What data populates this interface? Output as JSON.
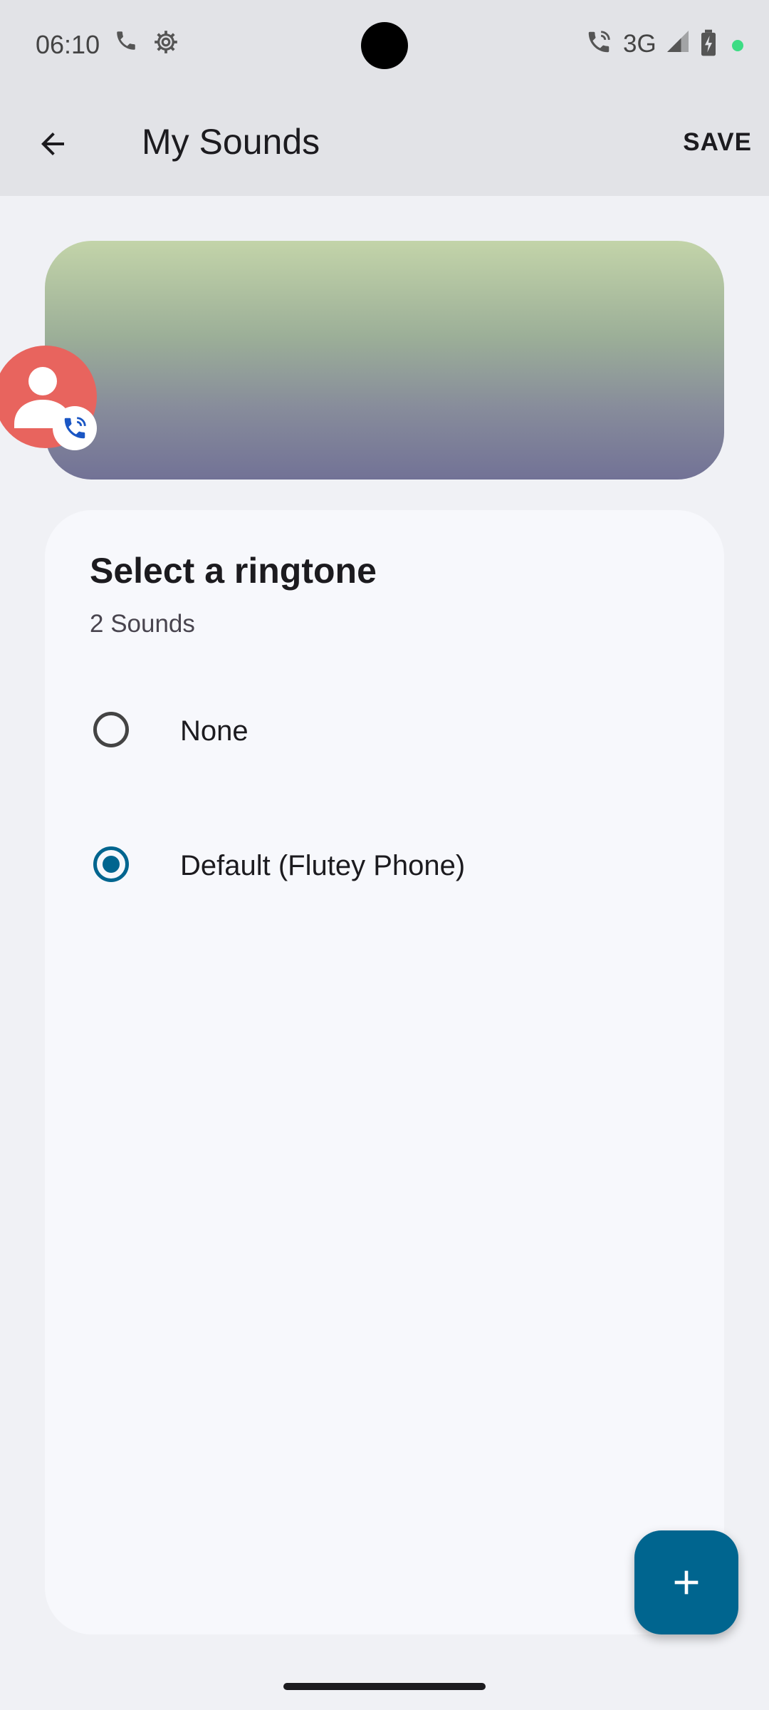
{
  "status_bar": {
    "time": "06:10",
    "network": "3G",
    "icons": [
      "phone-icon",
      "settings-gear-icon",
      "wifi-calling-icon",
      "signal-icon",
      "battery-charging-icon"
    ],
    "dot_color": "#3ddc84"
  },
  "app_bar": {
    "title": "My Sounds",
    "save_label": "SAVE"
  },
  "header": {
    "avatar_color": "#e8645e",
    "gradient_colors": [
      "#c3d4a9",
      "#727296"
    ]
  },
  "ringtone": {
    "title": "Select a ringtone",
    "subtitle": "2 Sounds",
    "options": [
      {
        "label": "None",
        "selected": false
      },
      {
        "label": "Default (Flutey Phone)",
        "selected": true
      }
    ]
  },
  "colors": {
    "accent": "#00658f",
    "background": "#f0f1f5",
    "card": "#f7f8fc"
  }
}
